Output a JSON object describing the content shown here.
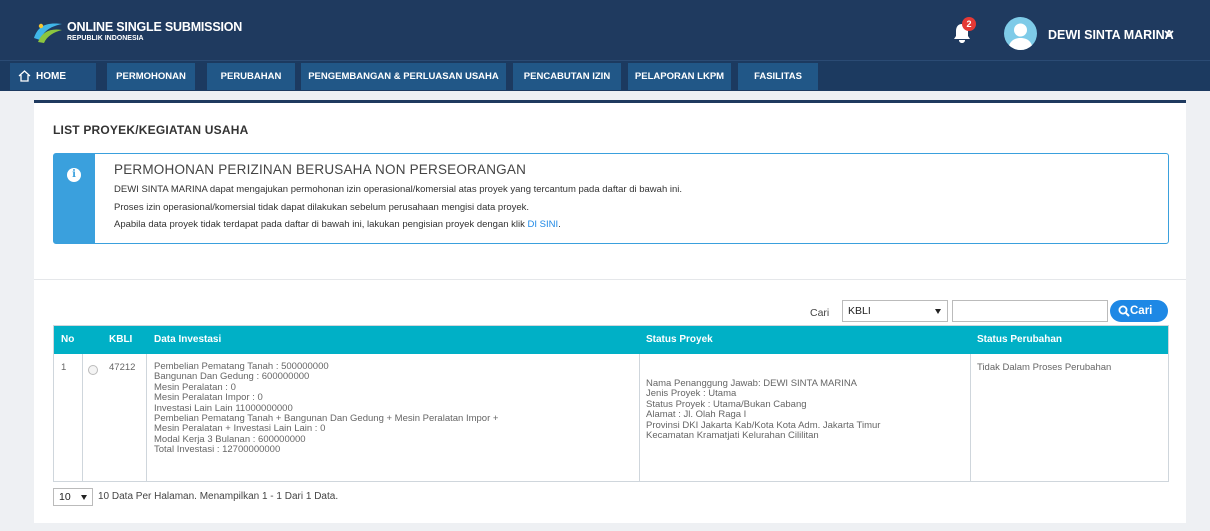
{
  "header": {
    "brand_title": "ONLINE SINGLE SUBMISSION",
    "brand_subtitle": "REPUBLIK INDONESIA",
    "notification_count": "2",
    "user_name": "DEWI SINTA MARINA",
    "icons": [
      "oss-logo-icon",
      "bell-icon",
      "avatar-icon",
      "chevron-down-icon"
    ]
  },
  "nav": {
    "home": "HOME",
    "items": [
      "PERMOHONAN",
      "PERUBAHAN",
      "PENGEMBANGAN & PERLUASAN USAHA",
      "PENCABUTAN IZIN",
      "PELAPORAN LKPM",
      "FASILITAS"
    ]
  },
  "page": {
    "title": "LIST PROYEK/KEGIATAN USAHA"
  },
  "info": {
    "title": "PERMOHONAN PERIZINAN BERUSAHA NON PERSEORANGAN",
    "line1": "DEWI SINTA MARINA dapat mengajukan permohonan izin operasional/komersial atas proyek yang tercantum pada daftar di bawah ini.",
    "line2": "Proses izin operasional/komersial tidak dapat dilakukan sebelum perusahaan mengisi data proyek.",
    "line3_prefix": "Apabila data proyek tidak terdapat pada daftar di bawah ini, lakukan pengisian proyek dengan klik ",
    "line3_link": "DI SINI",
    "line3_suffix": "."
  },
  "search": {
    "label": "Cari",
    "field_selected": "KBLI",
    "input_value": "",
    "button_label": "Cari"
  },
  "table": {
    "headers": [
      "No",
      "KBLI",
      "Data Investasi",
      "Status Proyek",
      "Status Perubahan"
    ],
    "rows": [
      {
        "no": "1",
        "kbli": "47212",
        "investasi": [
          "Pembelian Pematang Tanah : 500000000",
          "Bangunan Dan Gedung : 600000000",
          "Mesin Peralatan : 0",
          "Mesin Peralatan Impor : 0",
          "Investasi Lain Lain 11000000000",
          "Pembelian Pematang Tanah + Bangunan Dan Gedung + Mesin Peralatan Impor +",
          "Mesin Peralatan + Investasi Lain Lain : 0",
          "Modal Kerja 3 Bulanan : 600000000",
          "Total Investasi : 12700000000"
        ],
        "status_proyek": [
          "Nama Penanggung Jawab: DEWI SINTA MARINA",
          "Jenis Proyek : Utama",
          "Status Proyek : Utama/Bukan Cabang",
          "Alamat : Jl. Olah Raga I",
          "Provinsi DKI Jakarta Kab/Kota Kota Adm. Jakarta Timur",
          "Kecamatan Kramatjati Kelurahan Cililitan"
        ],
        "status_perubahan": "Tidak Dalam Proses Perubahan"
      }
    ]
  },
  "pagination": {
    "per_page": "10",
    "info": "10 Data Per Halaman. Menampilkan 1 - 1 Dari 1 Data."
  },
  "colors": {
    "topbar": "#1f3a5f",
    "nav_item": "#215787",
    "info_accent": "#3aa0dd",
    "table_header": "#00b0c6",
    "search_button": "#1e88e5",
    "badge": "#e53935"
  }
}
